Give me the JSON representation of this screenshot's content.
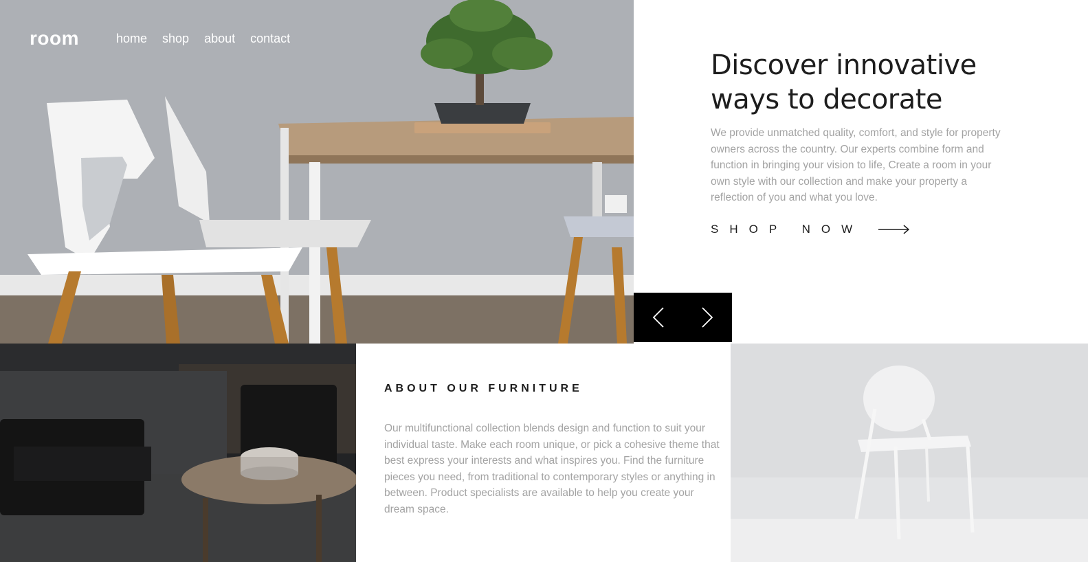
{
  "brand": {
    "logo": "room"
  },
  "nav": {
    "links": [
      {
        "label": "home"
      },
      {
        "label": "shop"
      },
      {
        "label": "about"
      },
      {
        "label": "contact"
      }
    ]
  },
  "hero": {
    "title": "Discover innovative ways to decorate",
    "description": "We provide unmatched quality, comfort, and style for property owners across the country. Our experts combine form and function in bringing your vision to life, Create a room in your own style with our collection and make your property a reflection of you and what you love.",
    "cta_label": "SHOP NOW",
    "cta_icon": "arrow-right-icon"
  },
  "slider": {
    "prev_icon": "chevron-left-icon",
    "next_icon": "chevron-right-icon"
  },
  "about": {
    "title": "ABOUT OUR FURNITURE",
    "text": "Our multifunctional collection blends design and function to suit your individual taste. Make each room unique, or pick a cohesive theme that best express your interests and what inspires you. Find the furniture pieces you need, from traditional to contemporary styles or anything in between. Product specialists are available to help you create your dream space."
  },
  "colors": {
    "text_dark": "#1d1d1d",
    "text_muted": "#a3a3a3",
    "slider_bg": "#000000",
    "background": "#ffffff"
  }
}
